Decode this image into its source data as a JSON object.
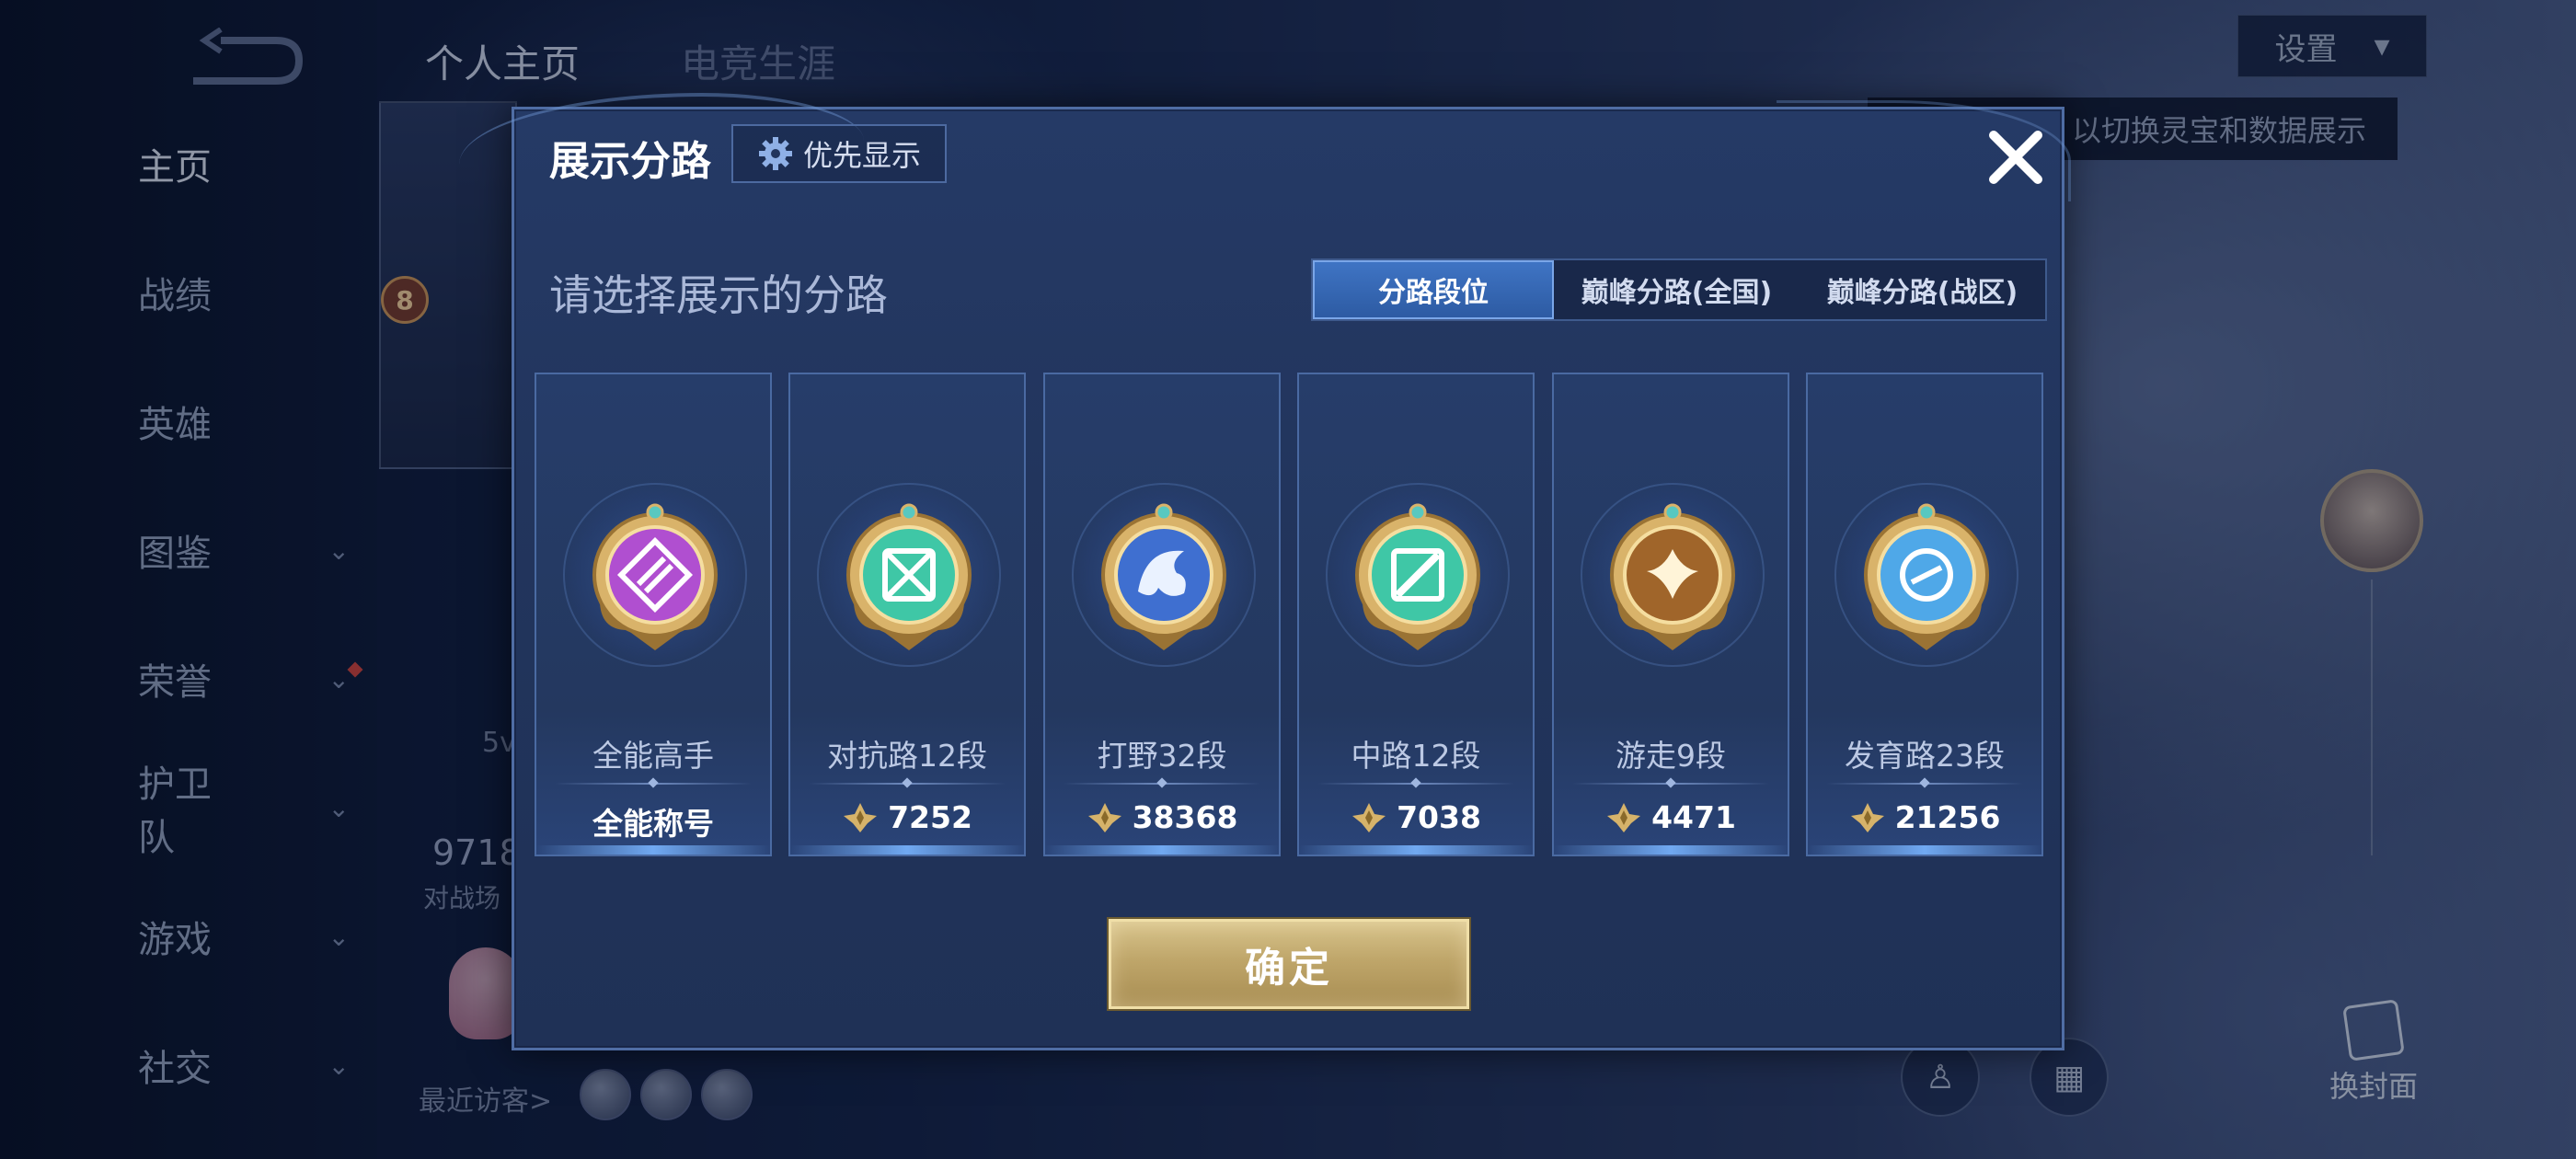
{
  "background": {
    "top_tabs": [
      "个人主页",
      "电竞生涯"
    ],
    "settings_label": "设置",
    "tooltip_text": "以切换灵宝和数据展示",
    "sidebar": [
      {
        "label": "主页",
        "has_chevron": false,
        "active": true
      },
      {
        "label": "战绩",
        "has_chevron": false
      },
      {
        "label": "英雄",
        "has_chevron": false
      },
      {
        "label": "图鉴",
        "has_chevron": true
      },
      {
        "label": "荣誉",
        "has_chevron": true
      },
      {
        "label": "护卫队",
        "has_chevron": true
      },
      {
        "label": "游戏",
        "has_chevron": true
      },
      {
        "label": "社交",
        "has_chevron": true
      }
    ],
    "level_badge": "8",
    "stat_partial": "9718",
    "stat_label_partial": "对战场",
    "tag_partial": "5v",
    "recent_visitors_label": "最近访客>",
    "cover_label": "换封面"
  },
  "modal": {
    "title": "展示分路",
    "priority_label": "优先显示",
    "heading": "请选择展示的分路",
    "tabs": [
      "分路段位",
      "巅峰分路(全国)",
      "巅峰分路(战区)"
    ],
    "active_tab": 0,
    "cards": [
      {
        "name": "全能高手",
        "value": "全能称号",
        "has_points_icon": false,
        "badge": "purple-allround",
        "color": "#b04fd0"
      },
      {
        "name": "对抗路12段",
        "value": "7252",
        "has_points_icon": true,
        "badge": "green-clash",
        "color": "#3fc7a6"
      },
      {
        "name": "打野32段",
        "value": "38368",
        "has_points_icon": true,
        "badge": "blue-jungle",
        "color": "#3f6fd0"
      },
      {
        "name": "中路12段",
        "value": "7038",
        "has_points_icon": true,
        "badge": "green-mid",
        "color": "#3fc7a6"
      },
      {
        "name": "游走9段",
        "value": "4471",
        "has_points_icon": true,
        "badge": "gold-roam",
        "color": "#b8802e"
      },
      {
        "name": "发育路23段",
        "value": "21256",
        "has_points_icon": true,
        "badge": "blue-farm",
        "color": "#4fa8e8"
      }
    ],
    "confirm_label": "确定",
    "colors": {
      "accent": "#3f74c4",
      "gold": "#d8c48c"
    }
  }
}
